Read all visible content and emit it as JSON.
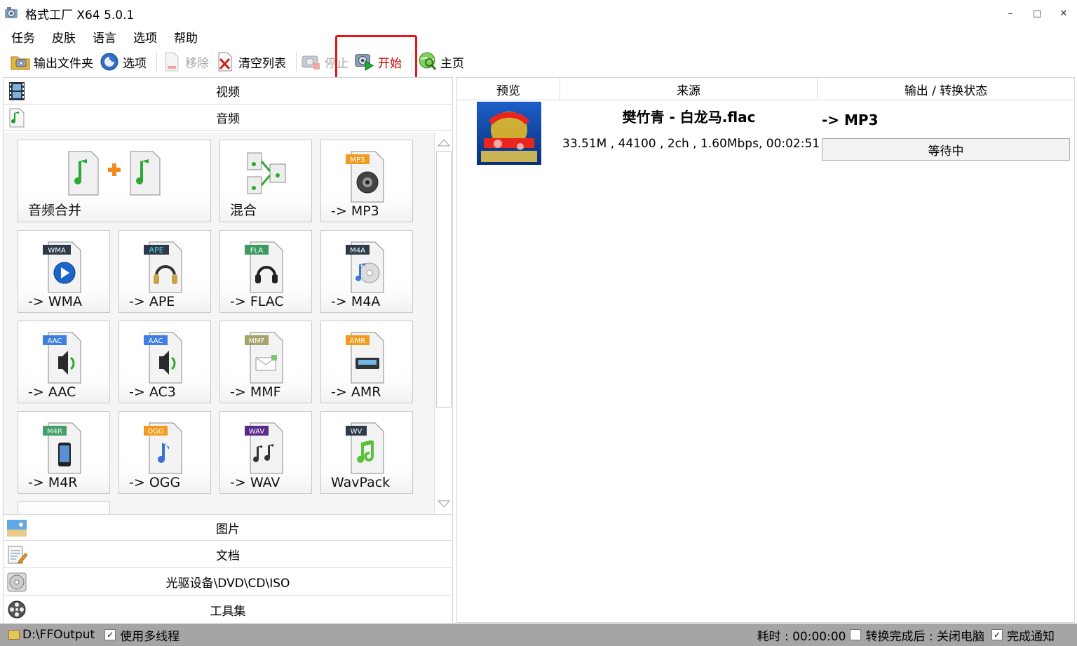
{
  "window": {
    "title": "格式工厂 X64 5.0.1",
    "minimize": "–",
    "maximize": "□",
    "close": "✕"
  },
  "menu": [
    "任务",
    "皮肤",
    "语言",
    "选项",
    "帮助"
  ],
  "toolbar": {
    "output_folder": "输出文件夹",
    "options": "选项",
    "remove": "移除",
    "clear_list": "清空列表",
    "stop": "停止",
    "start": "开始",
    "home": "主页"
  },
  "categories": {
    "video": "视频",
    "audio": "音频",
    "picture": "图片",
    "document": "文档",
    "disc": "光驱设备\\DVD\\CD\\ISO",
    "tools": "工具集"
  },
  "audio_tiles": [
    {
      "label": "音频合并",
      "icon": "audio-merge-icon"
    },
    {
      "label": "混合",
      "icon": "audio-mix-icon"
    },
    {
      "label": "-> MP3",
      "icon": "mp3-icon",
      "badge": "MP3"
    },
    {
      "label": "-> WMA",
      "icon": "wma-icon",
      "badge": "WMA"
    },
    {
      "label": "-> APE",
      "icon": "ape-icon",
      "badge": "APE"
    },
    {
      "label": "-> FLAC",
      "icon": "flac-icon",
      "badge": "FLA"
    },
    {
      "label": "-> M4A",
      "icon": "m4a-icon",
      "badge": "M4A"
    },
    {
      "label": "-> AAC",
      "icon": "aac-icon",
      "badge": "AAC"
    },
    {
      "label": "-> AC3",
      "icon": "ac3-icon",
      "badge": "AAC"
    },
    {
      "label": "-> MMF",
      "icon": "mmf-icon",
      "badge": "MMF"
    },
    {
      "label": "-> AMR",
      "icon": "amr-icon",
      "badge": "AMR"
    },
    {
      "label": "-> M4R",
      "icon": "m4r-icon",
      "badge": "M4R"
    },
    {
      "label": "-> OGG",
      "icon": "ogg-icon",
      "badge": "OGG"
    },
    {
      "label": "-> WAV",
      "icon": "wav-icon",
      "badge": "WAV"
    },
    {
      "label": "WavPack",
      "icon": "wavpack-icon",
      "badge": "WV"
    }
  ],
  "table": {
    "headers": [
      "预览",
      "来源",
      "输出 / 转换状态"
    ],
    "rows": [
      {
        "filename": "樊竹青 - 白龙马.flac",
        "info": "33.51M , 44100 , 2ch , 1.60Mbps, 00:02:51",
        "output": "-> MP3",
        "status": "等待中"
      }
    ]
  },
  "statusbar": {
    "output_path": "D:\\FFOutput",
    "multithread_label": "使用多线程",
    "multithread_checked": true,
    "elapsed": "耗时 : 00:00:00",
    "after_done_label": "转换完成后 : 关闭电脑",
    "after_done_checked": false,
    "notify_label": "完成通知",
    "notify_checked": true
  },
  "colors": {
    "start_label": "#cc0000",
    "highlight_box": "#e8141b",
    "statusbar_bg": "#a5a5a5"
  }
}
